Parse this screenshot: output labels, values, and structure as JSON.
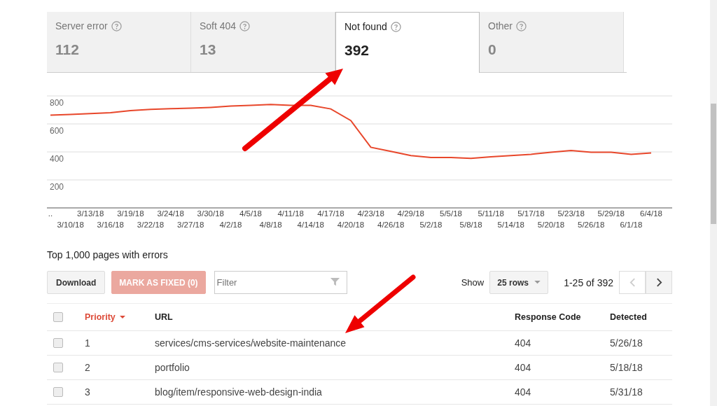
{
  "tabs": [
    {
      "label": "Server error",
      "count": "112",
      "selected": false
    },
    {
      "label": "Soft 404",
      "count": "13",
      "selected": false
    },
    {
      "label": "Not found",
      "count": "392",
      "selected": true
    },
    {
      "label": "Other",
      "count": "0",
      "selected": false
    }
  ],
  "chart": {
    "chart_data": {
      "type": "line",
      "categories": [
        "..",
        "3/10/18",
        "3/13/18",
        "3/16/18",
        "3/19/18",
        "3/22/18",
        "3/24/18",
        "3/27/18",
        "3/30/18",
        "4/2/18",
        "4/5/18",
        "4/8/18",
        "4/11/18",
        "4/14/18",
        "4/17/18",
        "4/20/18",
        "4/23/18",
        "4/26/18",
        "4/29/18",
        "5/2/18",
        "5/5/18",
        "5/8/18",
        "5/11/18",
        "5/14/18",
        "5/17/18",
        "5/20/18",
        "5/23/18",
        "5/26/18",
        "5/29/18",
        "6/1/18",
        "6/4/18"
      ],
      "series": [
        {
          "color": "#e8472b",
          "values": [
            662,
            668,
            674,
            680,
            695,
            704,
            709,
            712,
            718,
            727,
            733,
            739,
            733,
            733,
            707,
            624,
            433,
            404,
            374,
            360,
            360,
            354,
            365,
            374,
            383,
            398,
            410,
            398,
            398,
            383,
            392
          ]
        }
      ],
      "ylim": [
        0,
        800
      ],
      "yticks": [
        200,
        400,
        600,
        800
      ],
      "grid": true
    }
  },
  "section_title": "Top 1,000 pages with errors",
  "toolbar": {
    "download": "Download",
    "mark_fixed": {
      "label": "MARK AS FIXED (0)",
      "disabled": true
    },
    "filter": {
      "placeholder": "Filter"
    },
    "show_label": "Show",
    "rows_select": "25 rows",
    "pagination": "1-25 of 392"
  },
  "table": {
    "header_checked": false,
    "columns": [
      {
        "label": "Priority",
        "sorted": true
      },
      {
        "label": "URL",
        "sorted": false
      },
      {
        "label": "Response Code",
        "sorted": false
      },
      {
        "label": "Detected",
        "sorted": false
      }
    ],
    "rows": [
      {
        "checked": false,
        "priority": "1",
        "url": "services/cms-services/website-maintenance",
        "code": "404",
        "detected": "5/26/18"
      },
      {
        "checked": false,
        "priority": "2",
        "url": "portfolio",
        "code": "404",
        "detected": "5/18/18"
      },
      {
        "checked": false,
        "priority": "3",
        "url": "blog/item/responsive-web-design-india",
        "code": "404",
        "detected": "5/31/18"
      }
    ]
  }
}
